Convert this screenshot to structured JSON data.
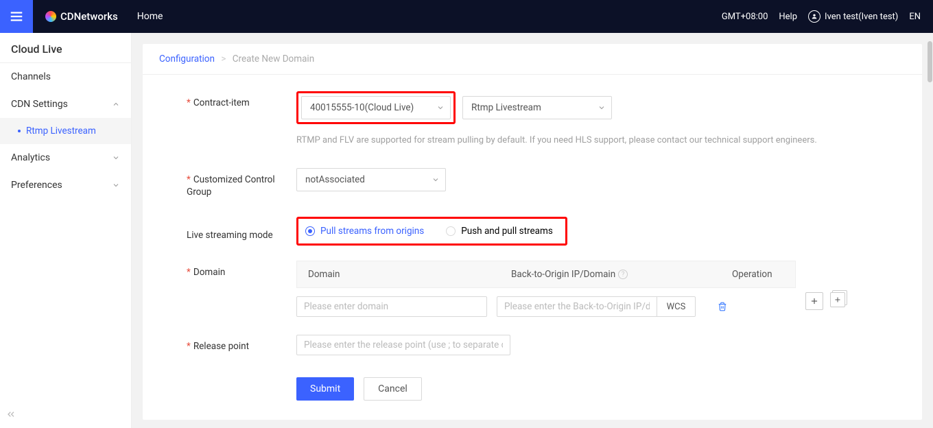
{
  "header": {
    "brand": "CDNetworks",
    "home": "Home",
    "timezone": "GMT+08:00",
    "help": "Help",
    "user": "Iven test(Iven test)",
    "lang": "EN"
  },
  "sidebar": {
    "title": "Cloud Live",
    "items": {
      "channels": "Channels",
      "cdn_settings": "CDN Settings",
      "rtmp": "Rtmp Livestream",
      "analytics": "Analytics",
      "preferences": "Preferences"
    }
  },
  "breadcrumb": {
    "parent": "Configuration",
    "current": "Create New Domain"
  },
  "form": {
    "contract": {
      "label": "Contract-item",
      "select1": "40015555-10(Cloud Live)",
      "select2": "Rtmp Livestream",
      "helper": "RTMP and FLV are supported for stream pulling by default. If you need HLS support, please contact our technical support engineers."
    },
    "ccg": {
      "label": "Customized Control Group",
      "value": "notAssociated"
    },
    "mode": {
      "label": "Live streaming mode",
      "opt1": "Pull streams from origins",
      "opt2": "Push and pull streams"
    },
    "domain": {
      "label": "Domain",
      "col_domain": "Domain",
      "col_origin": "Back-to-Origin IP/Domain",
      "col_op": "Operation",
      "ph_domain": "Please enter domain",
      "ph_origin": "Please enter the Back-to-Origin IP/domain",
      "wcs": "WCS"
    },
    "release": {
      "label": "Release point",
      "placeholder": "Please enter the release point (use ; to separate different points)"
    },
    "buttons": {
      "submit": "Submit",
      "cancel": "Cancel"
    }
  }
}
